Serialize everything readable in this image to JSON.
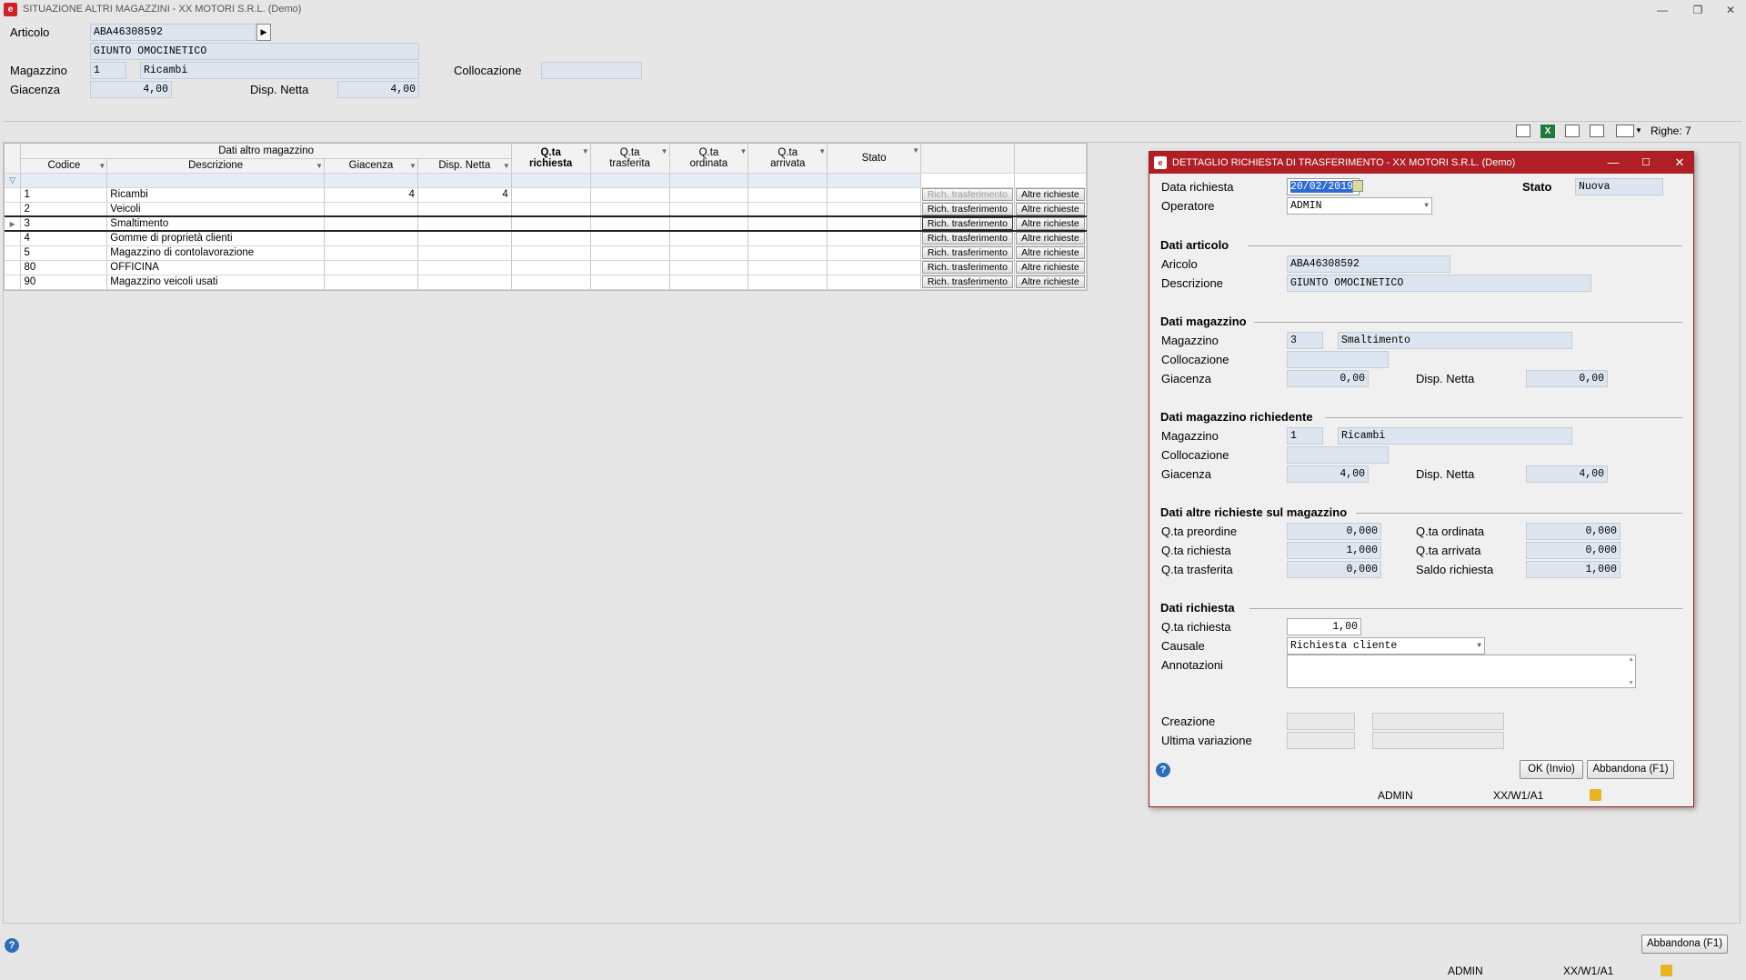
{
  "main": {
    "title": "SITUAZIONE ALTRI MAGAZZINI - XX  MOTORI S.R.L.  (Demo)",
    "articolo_label": "Articolo",
    "articolo_code": "ABA46308592",
    "articolo_desc": "GIUNTO OMOCINETICO",
    "magazzino_label": "Magazzino",
    "magazzino_code": "1",
    "magazzino_name": "Ricambi",
    "collocazione_label": "Collocazione",
    "collocazione_value": "",
    "giacenza_label": "Giacenza",
    "giacenza_value": "4,00",
    "disp_netta_label": "Disp. Netta",
    "disp_netta_value": "4,00",
    "righe": "Righe: 7",
    "abbandona": "Abbandona (F1)",
    "status_user": "ADMIN",
    "status_ws": "XX/W1/A1"
  },
  "grid": {
    "group_header": "Dati altro magazzino",
    "headers": {
      "codice": "Codice",
      "descrizione": "Descrizione",
      "giacenza": "Giacenza",
      "disp_netta": "Disp. Netta",
      "qta_richiesta_1": "Q.ta",
      "qta_richiesta_2": "richiesta",
      "qta_trasferita_1": "Q.ta",
      "qta_trasferita_2": "trasferita",
      "qta_ordinata_1": "Q.ta",
      "qta_ordinata_2": "ordinata",
      "qta_arrivata_1": "Q.ta",
      "qta_arrivata_2": "arrivata",
      "stato": "Stato"
    },
    "btn_rich": "Rich. trasferimento",
    "btn_altre": "Altre richieste",
    "rows": [
      {
        "codice": "1",
        "descrizione": "Ricambi",
        "giacenza": "4",
        "disp": "4"
      },
      {
        "codice": "2",
        "descrizione": "Veicoli",
        "giacenza": "",
        "disp": ""
      },
      {
        "codice": "3",
        "descrizione": "Smaltimento",
        "giacenza": "",
        "disp": ""
      },
      {
        "codice": "4",
        "descrizione": "Gomme di proprietà clienti",
        "giacenza": "",
        "disp": ""
      },
      {
        "codice": "5",
        "descrizione": "Magazzino di contolavorazione",
        "giacenza": "",
        "disp": ""
      },
      {
        "codice": "80",
        "descrizione": "OFFICINA",
        "giacenza": "",
        "disp": ""
      },
      {
        "codice": "90",
        "descrizione": "Magazzino veicoli usati",
        "giacenza": "",
        "disp": ""
      }
    ]
  },
  "dialog": {
    "title": "DETTAGLIO RICHIESTA DI TRASFERIMENTO - XX  MOTORI S.R.L.  (Demo)",
    "data_richiesta_label": "Data richiesta",
    "data_richiesta": "20/02/2019",
    "stato_label": "Stato",
    "stato": "Nuova",
    "operatore_label": "Operatore",
    "operatore": "ADMIN",
    "sec_articolo": "Dati articolo",
    "aricolo_label": "Aricolo",
    "aricolo": "ABA46308592",
    "descrizione_label": "Descrizione",
    "descrizione": "GIUNTO OMOCINETICO",
    "sec_magazzino": "Dati magazzino",
    "mag_label": "Magazzino",
    "mag_code": "3",
    "mag_name": "Smaltimento",
    "colloc_label": "Collocazione",
    "giac_label": "Giacenza",
    "giac": "0,00",
    "disp_label": "Disp. Netta",
    "disp": "0,00",
    "sec_mag_rich": "Dati magazzino richiedente",
    "mag2_code": "1",
    "mag2_name": "Ricambi",
    "giac2": "4,00",
    "disp2": "4,00",
    "sec_altre": "Dati altre richieste sul magazzino",
    "preordine_label": "Q.ta preordine",
    "preordine": "0,000",
    "ordinata_label": "Q.ta ordinata",
    "ordinata": "0,000",
    "richiesta_label": "Q.ta richiesta",
    "richiesta": "1,000",
    "arrivata_label": "Q.ta arrivata",
    "arrivata": "0,000",
    "trasferita_label": "Q.ta trasferita",
    "trasferita": "0,000",
    "saldo_label": "Saldo richiesta",
    "saldo": "1,000",
    "sec_richiesta": "Dati richiesta",
    "qta_rich_label": "Q.ta richiesta",
    "qta_rich": "1,00",
    "causale_label": "Causale",
    "causale": "Richiesta cliente",
    "annotazioni_label": "Annotazioni",
    "annotazioni": "",
    "creazione_label": "Creazione",
    "ultima_label": "Ultima variazione",
    "ok": "OK (Invio)",
    "abbandona": "Abbandona (F1)",
    "status_user": "ADMIN",
    "status_ws": "XX/W1/A1"
  }
}
